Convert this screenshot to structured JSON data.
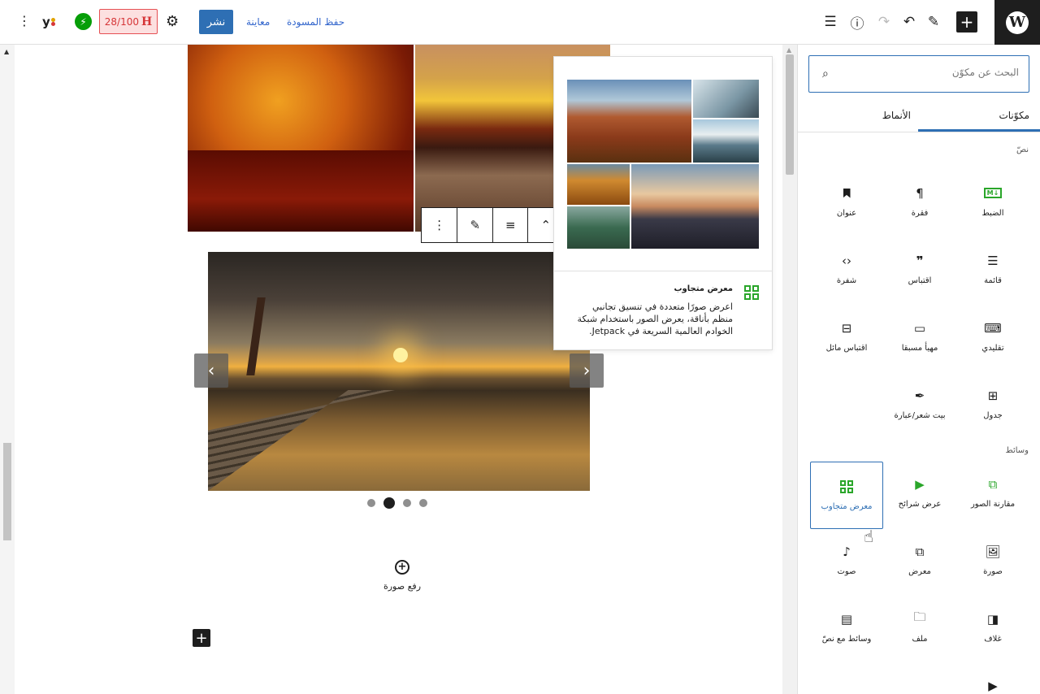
{
  "topbar": {
    "publish_label": "نشر",
    "preview_label": "معاينة",
    "save_draft_label": "حفظ المسودة",
    "seo_score": "28/100",
    "seo_icon": "H",
    "icons": [
      "wordpress-logo-icon",
      "add-block-icon",
      "pen-icon",
      "undo-icon",
      "redo-icon",
      "info-icon",
      "list-view-icon",
      "gear-icon",
      "jetpack-icon",
      "yoast-icon",
      "kebab-icon"
    ]
  },
  "canvas": {
    "upload_label": "رفع صورة",
    "slideshow_dots": 4,
    "active_dot": 2
  },
  "preview_card": {
    "title": "معرض متجاوب",
    "description": "اعرض صورًا متعددة في تنسيق تجانبي منظم بأناقة، يعرض الصور باستخدام شبكة الخوادم العالمية السريعة في Jetpack."
  },
  "sidebar": {
    "search_placeholder": "البحث عن مكوّن",
    "tabs": [
      {
        "label": "مكوّنات",
        "active": true
      },
      {
        "label": "الأنماط",
        "active": false
      }
    ],
    "sections": [
      {
        "label": "نصّ"
      },
      {
        "label": "وسائط"
      }
    ],
    "text_blocks": [
      {
        "label": "الضبط",
        "icon": "markdown-icon",
        "green": true
      },
      {
        "label": "فقرة",
        "icon": "paragraph-icon"
      },
      {
        "label": "عنوان",
        "icon": "bookmark-icon"
      },
      {
        "label": "قائمة",
        "icon": "list-icon"
      },
      {
        "label": "اقتباس",
        "icon": "quote-icon"
      },
      {
        "label": "شفرة",
        "icon": "code-icon"
      },
      {
        "label": "تقليدي",
        "icon": "keyboard-icon"
      },
      {
        "label": "مهيأ مسبقا",
        "icon": "preformatted-icon"
      },
      {
        "label": "اقتباس مائل",
        "icon": "pullquote-icon"
      },
      {
        "label": "جدول",
        "icon": "table-icon"
      },
      {
        "label": "بيت شعر/عبارة",
        "icon": "feather-icon"
      }
    ],
    "media_blocks": [
      {
        "label": "مقارنة الصور",
        "icon": "image-compare-icon",
        "green": true
      },
      {
        "label": "عرض شرائح",
        "icon": "slideshow-icon",
        "green": true
      },
      {
        "label": "معرض متجاوب",
        "icon": "tiled-gallery-icon",
        "green": true,
        "selected": true
      },
      {
        "label": "صورة",
        "icon": "image-icon"
      },
      {
        "label": "معرض",
        "icon": "gallery-icon"
      },
      {
        "label": "صوت",
        "icon": "audio-icon"
      },
      {
        "label": "غلاف",
        "icon": "cover-icon"
      },
      {
        "label": "ملف",
        "icon": "folder-icon"
      },
      {
        "label": "وسائط مع نصّ",
        "icon": "media-text-icon"
      }
    ]
  },
  "colors": {
    "accent": "#2e6fb4",
    "jetpack_green": "#2aa62a",
    "seo_red": "#d63638",
    "dark": "#1e1e1e"
  }
}
